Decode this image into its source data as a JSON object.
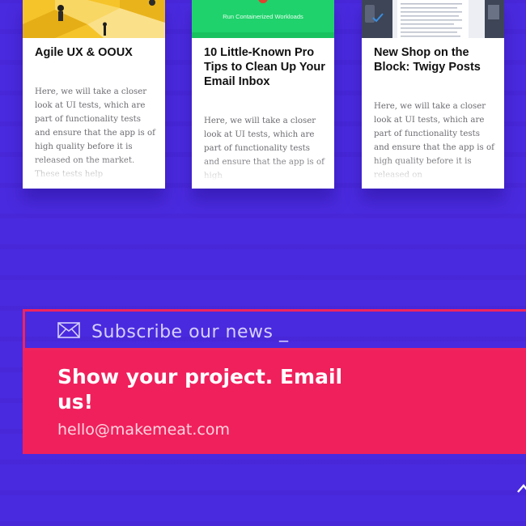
{
  "cards": [
    {
      "title": "Agile UX & OOUX",
      "excerpt": "Here, we will take a closer look at UI tests, which are part of functionality tests and ensure that the app is of high quality before it is released on the market. These tests help"
    },
    {
      "title": "10 Little-Known Pro Tips to Clean Up Your Email Inbox",
      "thumb_caption": "Run Containerized Workloads",
      "excerpt": "Here, we will take a closer look at UI tests, which are part of functionality tests and ensure that the app is of high"
    },
    {
      "title": "New Shop on the Block: Twigy Posts",
      "excerpt": "Here, we will take a closer look at UI tests, which are part of functionality tests and ensure that the app is of high quality before it is released on"
    }
  ],
  "subscribe": {
    "label": "Subscribe our news _",
    "icon": "envelope-icon"
  },
  "contact": {
    "headline": "Show your project. Email us!",
    "email": "hello@makemeat.com"
  },
  "colors": {
    "background": "#4a2ade",
    "accent": "#f0205c",
    "card": "#ffffff"
  }
}
